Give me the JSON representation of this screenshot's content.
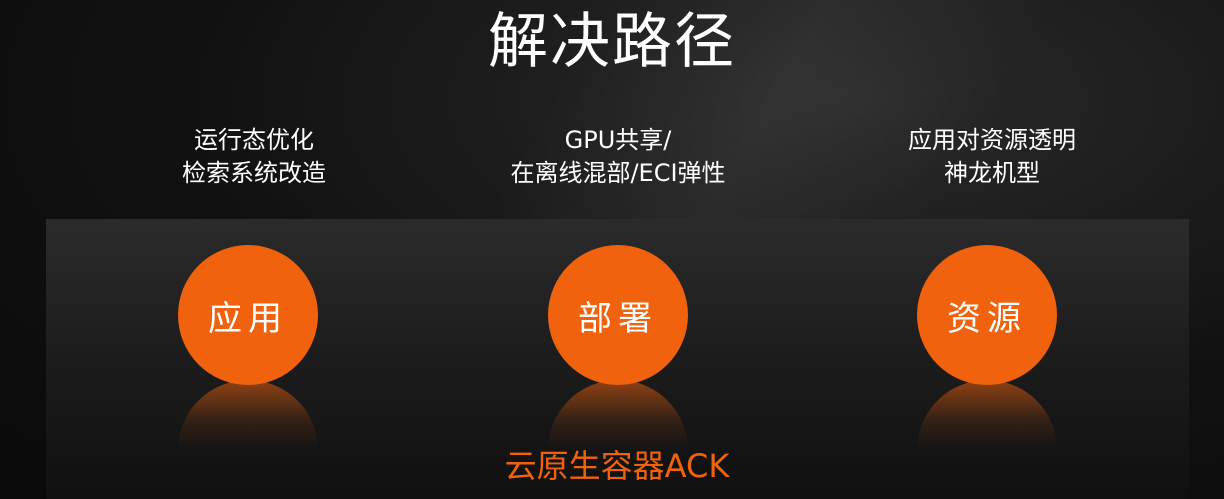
{
  "title": "解决路径",
  "columns": [
    {
      "desc_line1": "运行态优化",
      "desc_line2": "检索系统改造",
      "circle_label": "应用"
    },
    {
      "desc_line1": "GPU共享/",
      "desc_line2": "在离线混部/ECI弹性",
      "circle_label": "部署"
    },
    {
      "desc_line1": "应用对资源透明",
      "desc_line2": "神龙机型",
      "circle_label": "资源"
    }
  ],
  "footer": "云原生容器ACK",
  "colors": {
    "accent": "#f0620d",
    "background": "#111111",
    "text": "#ffffff"
  }
}
